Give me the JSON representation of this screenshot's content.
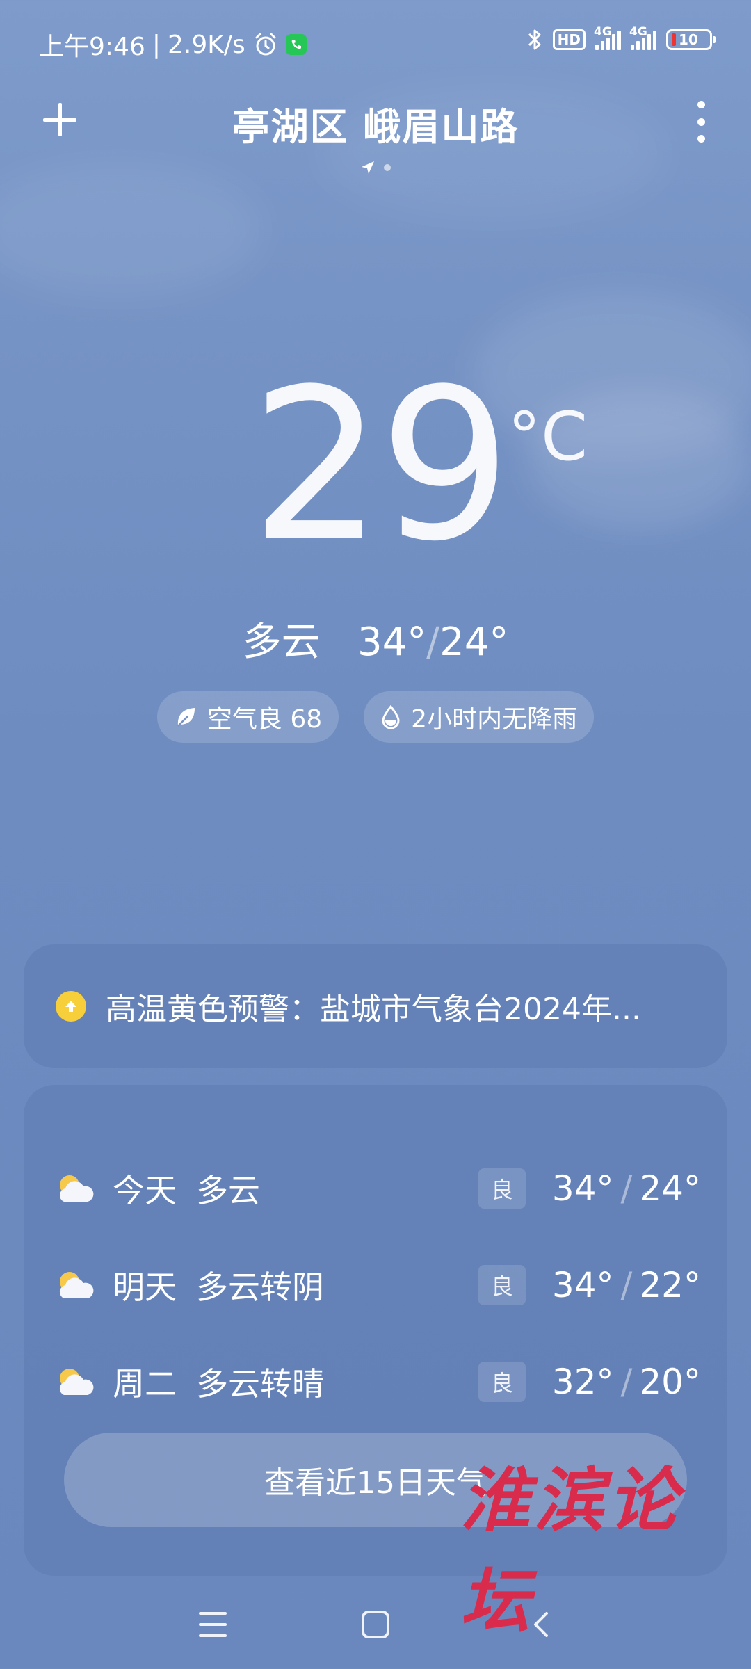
{
  "status_bar": {
    "time": "上午9:46",
    "speed": "2.9K/s",
    "hd": "HD",
    "net1": "4G",
    "net2": "4G",
    "battery": "10"
  },
  "header": {
    "title": "亭湖区 峨眉山路"
  },
  "current": {
    "temp": "29",
    "unit": "°C",
    "condition": "多云",
    "high": "34°",
    "low": "24°",
    "air_quality": "空气良 68",
    "rain": "2小时内无降雨"
  },
  "warning": {
    "text": "高温黄色预警：盐城市气象台2024年..."
  },
  "forecast": [
    {
      "day": "今天",
      "desc": "多云",
      "aqi": "良",
      "high": "34°",
      "low": "24°"
    },
    {
      "day": "明天",
      "desc": "多云转阴",
      "aqi": "良",
      "high": "34°",
      "low": "22°"
    },
    {
      "day": "周二",
      "desc": "多云转晴",
      "aqi": "良",
      "high": "32°",
      "low": "20°"
    }
  ],
  "more_button": "查看近15日天气",
  "watermark": "淮滨论坛",
  "colors": {
    "background": "#7693c5",
    "warning_icon": "#f7cf3a",
    "call_icon": "#26c756",
    "watermark": "#d92b4b"
  }
}
